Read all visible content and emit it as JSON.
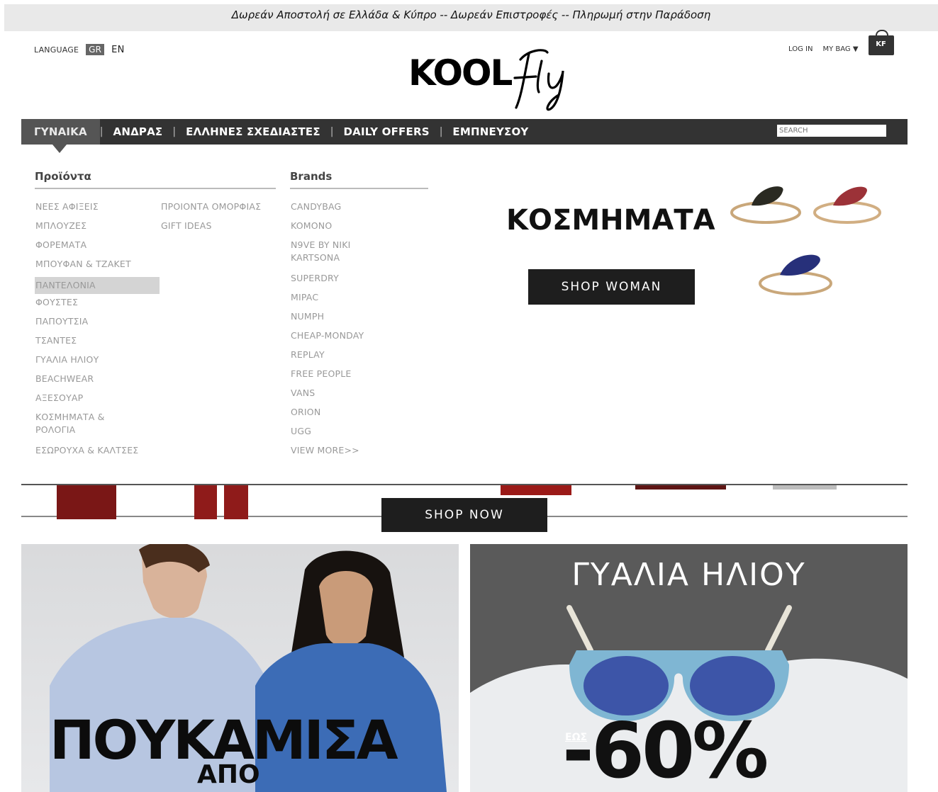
{
  "promo_bar": {
    "text": "Δωρεάν Αποστολή σε Ελλάδα & Κύπρο -- Δωρεάν Επιστροφές -- Πληρωμή στην Παράδοση"
  },
  "header": {
    "language_label": "LANGUAGE",
    "lang_gr": "GR",
    "lang_en": "EN",
    "logo_text": "KOOL",
    "logo_script": "Fly",
    "login": "LOG IN",
    "my_bag": "MY BAG ▼",
    "bag_badge": "KF"
  },
  "nav": {
    "items": [
      "ΓΥΝΑΙΚΑ",
      "ΑΝΔΡΑΣ",
      "ΕΛΛΗΝΕΣ ΣΧΕΔΙΑΣΤΕΣ",
      "DAILY OFFERS",
      "ΕΜΠΝΕΥΣΟΥ"
    ],
    "separator": "|",
    "search_placeholder": "SEARCH"
  },
  "mega_menu": {
    "products_heading": "Προϊόντα",
    "brands_heading": "Brands",
    "products_col1": [
      "ΝΕΕΣ ΑΦΙΞΕΙΣ",
      "ΜΠΛΟΥΖΕΣ",
      "ΦΟΡΕΜΑΤΑ",
      "ΜΠΟΥΦΑΝ & ΤΖΑΚΕΤ",
      "ΠΑΝΤΕΛΟΝΙΑ",
      "ΦΟΥΣΤΕΣ",
      "ΠΑΠΟΥΤΣΙΑ",
      "ΤΣΑΝΤΕΣ",
      "ΓΥΑΛΙΑ ΗΛΙΟΥ",
      "BEACHWEAR",
      "ΑΞΕΣΟΥΑΡ",
      "ΚΟΣΜΗΜΑΤΑ & ΡΟΛΟΓΙΑ",
      "ΕΣΩΡΟΥΧΑ & ΚΑΛΤΣΕΣ"
    ],
    "products_col2": [
      "ΠΡΟΙΟΝΤΑ ΟΜΟΡΦΙΑΣ",
      "GIFT IDEAS"
    ],
    "brands": [
      "CANDYBAG",
      "KOMONO",
      "N9VE BY NIKI KARTSONA",
      "SUPERDRY",
      "MIPAC",
      "NUMPH",
      "CHEAP-MONDAY",
      "REPLAY",
      "FREE PEOPLE",
      "VANS",
      "ORION",
      "UGG",
      "VIEW MORE>>"
    ],
    "promo_title": "ΚΟΣΜΗΜΑΤΑ",
    "promo_button": "SHOP WOMAN"
  },
  "strip": {
    "button": "SHOP NOW"
  },
  "banners": {
    "left_headline": "ΠΟΥΚΑΜΙΣΑ",
    "left_sub": "ΑΠΟ",
    "right_title": "ΓΥΑΛΙΑ ΗΛΙΟΥ",
    "right_eos": "ΕΩΣ",
    "right_pct": "-60%"
  },
  "colors": {
    "nav_bg": "#333333",
    "nav_active": "#555555",
    "button_bg": "#1e1e1e",
    "promo_bg": "#e9e9e9"
  }
}
